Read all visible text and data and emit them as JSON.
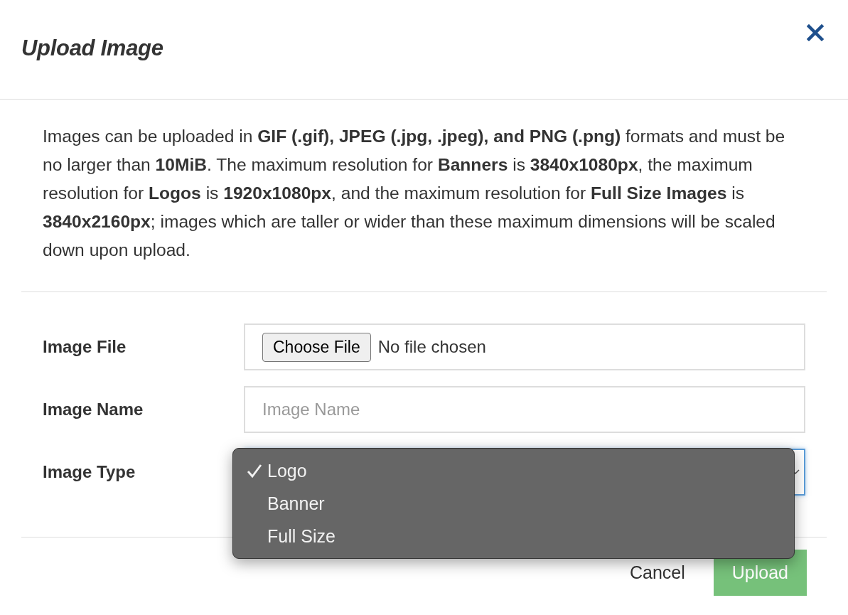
{
  "dialog": {
    "title": "Upload Image"
  },
  "description": "Images can be uploaded in **GIF (.gif), JPEG (.jpg, .jpeg), and PNG (.png)** formats and must be no larger than **10MiB**. The maximum resolution for **Banners** is **3840x1080px**, the maximum resolution for **Logos** is **1920x1080px**, and the maximum resolution for **Full Size Images** is **3840x2160px**; images which are taller or wider than these maximum dimensions will be scaled down upon upload.",
  "fields": [
    {
      "kind": "file",
      "label": "Image File",
      "button": "Choose File",
      "value": "No file chosen"
    },
    {
      "kind": "text",
      "label": "Image Name",
      "placeholder": "Image Name"
    },
    {
      "kind": "select",
      "label": "Image Type",
      "options": [
        {
          "label": "Logo",
          "selected": true
        },
        {
          "label": "Banner",
          "selected": false
        },
        {
          "label": "Full Size",
          "selected": false
        }
      ]
    }
  ],
  "buttons": [
    {
      "kind": "link",
      "label": "Cancel"
    },
    {
      "kind": "primary",
      "label": "Upload"
    }
  ]
}
